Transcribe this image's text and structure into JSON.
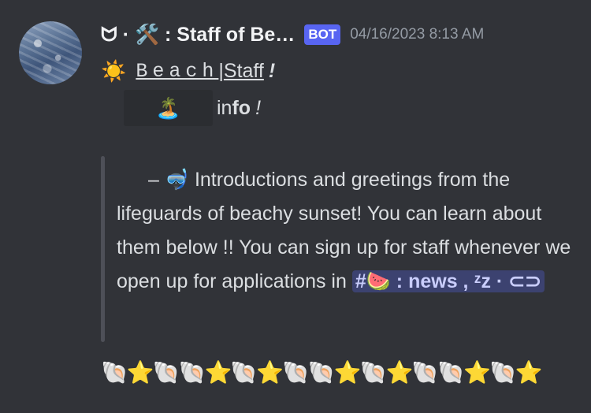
{
  "message": {
    "author": "ᗢ · 🛠️ : Staff of Be…",
    "bot_tag": "BOT",
    "timestamp": "04/16/2023 8:13 AM",
    "avatar_alt": "ocean waves"
  },
  "content": {
    "line1_emoji": "☀️",
    "line1_beach": "Beach",
    "line1_sep": "|",
    "line1_staff": "Staff",
    "line1_bang": "!",
    "line2_emoji": "🏝️",
    "line2_in": "in",
    "line2_fo": "fo",
    "line2_bang": "!",
    "quote_lead": "–",
    "quote_emoji": "🤿",
    "quote_text": "Introductions and greetings from the lifeguards of beachy sunset! You can learn about them below !! You can sign up for staff whenever we open up for applications in",
    "channel_mention": "#🍉 : news , ᶻz · ⊂⊃",
    "decorations": "🐚⭐🐚🐚⭐🐚⭐🐚🐚⭐🐚⭐🐚🐚⭐🐚⭐"
  }
}
